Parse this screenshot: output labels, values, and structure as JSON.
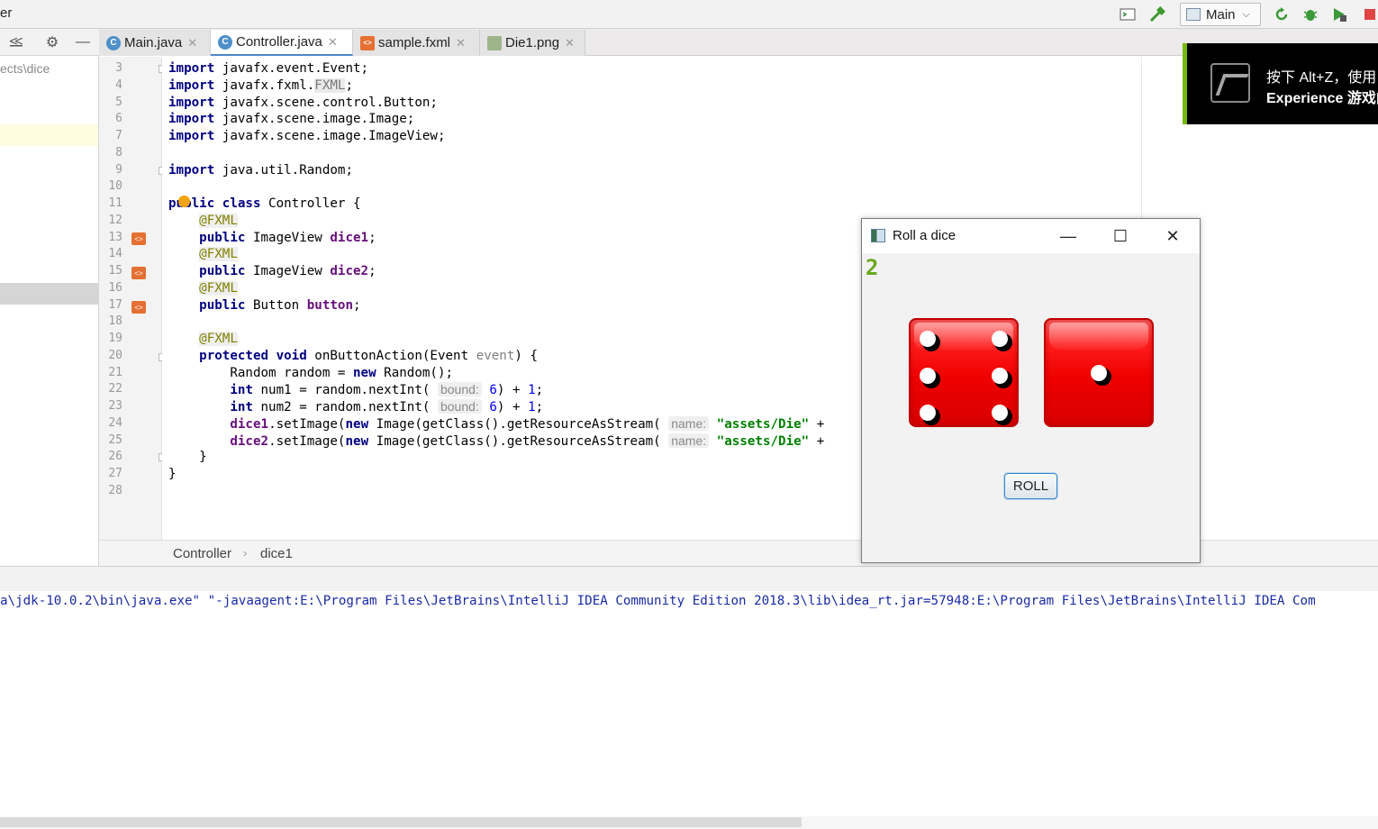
{
  "app": {
    "title_fragment": "er"
  },
  "toolbar": {
    "run_config": "Main"
  },
  "project": {
    "path_fragment": "ects\\dice"
  },
  "tabs": [
    {
      "label": "Main.java",
      "kind": "java"
    },
    {
      "label": "Controller.java",
      "kind": "java",
      "active": true
    },
    {
      "label": "sample.fxml",
      "kind": "fxml"
    },
    {
      "label": "Die1.png",
      "kind": "png"
    }
  ],
  "editor": {
    "line_numbers": [
      "3",
      "4",
      "5",
      "6",
      "7",
      "8",
      "9",
      "10",
      "11",
      "12",
      "13",
      "14",
      "15",
      "16",
      "17",
      "18",
      "19",
      "20",
      "21",
      "22",
      "23",
      "24",
      "25",
      "26",
      "27",
      "28"
    ],
    "hints": {
      "bound": "bound:",
      "name": "name:"
    }
  },
  "breadcrumb": {
    "class_name": "Controller",
    "member": "dice1"
  },
  "console": {
    "line": "a\\jdk-10.0.2\\bin\\java.exe\" \"-javaagent:E:\\Program Files\\JetBrains\\IntelliJ IDEA Community Edition 2018.3\\lib\\idea_rt.jar=57948:E:\\Program Files\\JetBrains\\IntelliJ IDEA Com"
  },
  "overlay": {
    "line1": "按下 Alt+Z，使用",
    "line2": "Experience 游戏内"
  },
  "fx_window": {
    "title": "Roll a dice",
    "count": "2",
    "die1_value": 6,
    "die2_value": 1,
    "roll_label": "ROLL"
  },
  "colors": {
    "keyword": "#000080",
    "annotation": "#808000",
    "field": "#660e7a",
    "number": "#0000ff",
    "string": "#008000",
    "console_text": "#1a2aa6",
    "overlay_accent": "#76b900",
    "die_red": "#ef0000"
  }
}
